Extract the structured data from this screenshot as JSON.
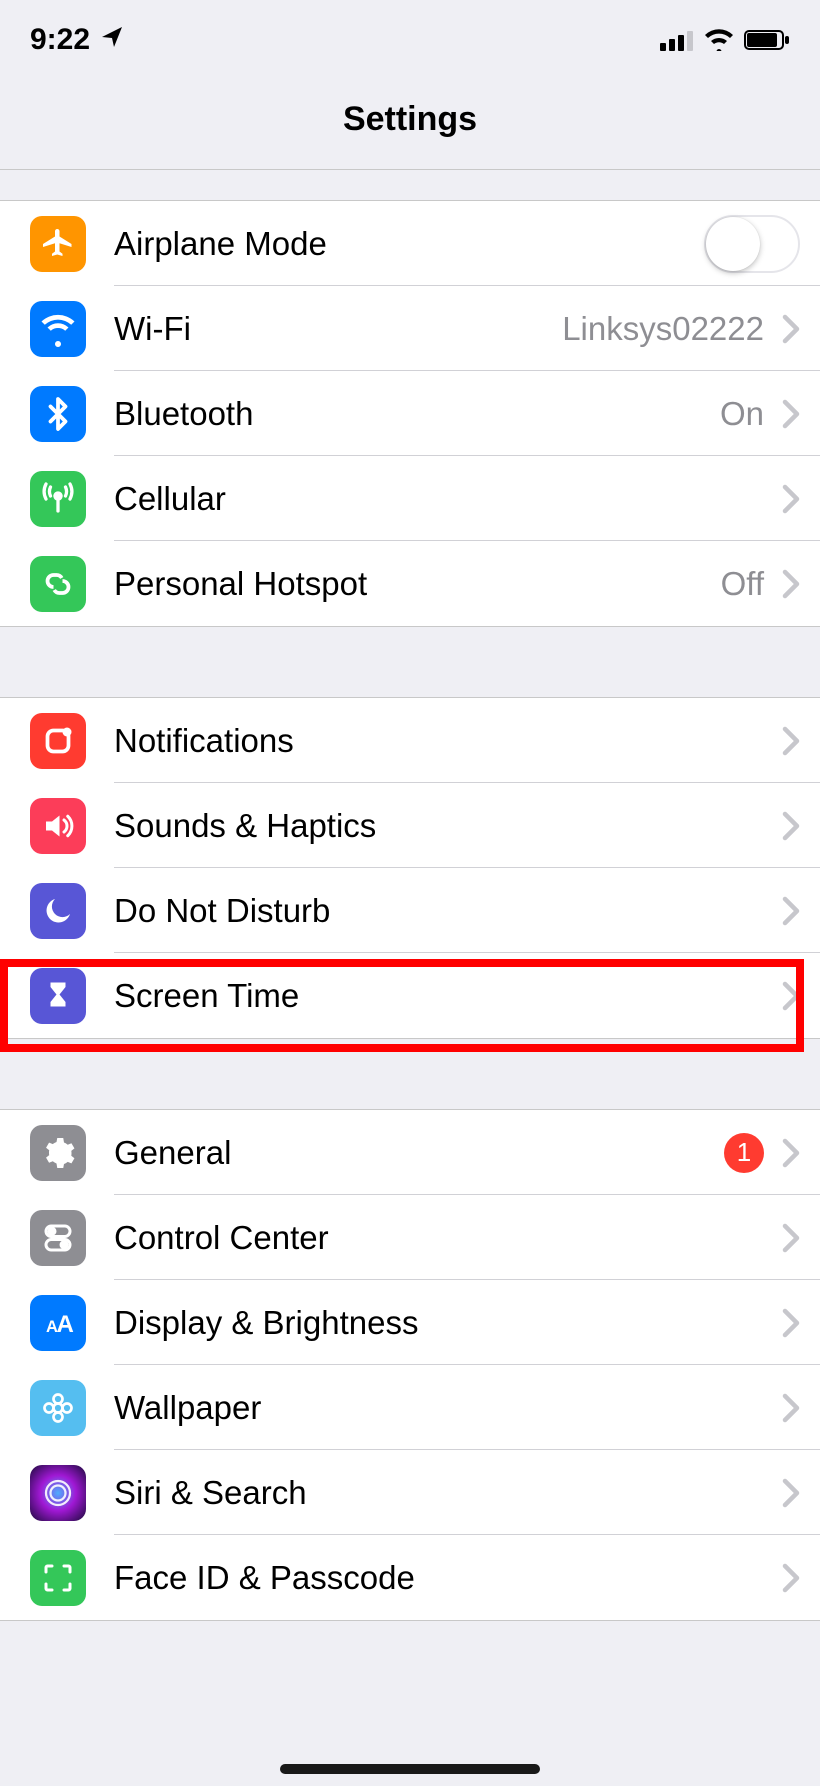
{
  "status": {
    "time": "9:22",
    "location_icon": "location-arrow",
    "cellular_icon": "cellular-signal",
    "wifi_icon": "wifi-signal",
    "battery_icon": "battery"
  },
  "title": "Settings",
  "groups": [
    {
      "rows": [
        {
          "id": "airplane-mode",
          "icon": "airplane-icon",
          "icon_bg": "bg-orange",
          "label": "Airplane Mode",
          "control": "toggle",
          "toggle_on": false
        },
        {
          "id": "wifi",
          "icon": "wifi-icon",
          "icon_bg": "bg-blue",
          "label": "Wi-Fi",
          "detail": "Linksys02222",
          "chevron": true
        },
        {
          "id": "bluetooth",
          "icon": "bluetooth-icon",
          "icon_bg": "bg-blue",
          "label": "Bluetooth",
          "detail": "On",
          "chevron": true
        },
        {
          "id": "cellular",
          "icon": "cellular-icon",
          "icon_bg": "bg-green",
          "label": "Cellular",
          "chevron": true
        },
        {
          "id": "hotspot",
          "icon": "hotspot-icon",
          "icon_bg": "bg-green",
          "label": "Personal Hotspot",
          "detail": "Off",
          "chevron": true
        }
      ]
    },
    {
      "rows": [
        {
          "id": "notifications",
          "icon": "notifications-icon",
          "icon_bg": "bg-red",
          "label": "Notifications",
          "chevron": true
        },
        {
          "id": "sounds",
          "icon": "speaker-icon",
          "icon_bg": "bg-pink",
          "label": "Sounds & Haptics",
          "chevron": true
        },
        {
          "id": "dnd",
          "icon": "moon-icon",
          "icon_bg": "bg-indigo",
          "label": "Do Not Disturb",
          "chevron": true
        },
        {
          "id": "screen-time",
          "icon": "hourglass-icon",
          "icon_bg": "bg-indigo",
          "label": "Screen Time",
          "chevron": true,
          "highlighted": true
        }
      ]
    },
    {
      "rows": [
        {
          "id": "general",
          "icon": "gear-icon",
          "icon_bg": "bg-gray",
          "label": "General",
          "badge": "1",
          "chevron": true
        },
        {
          "id": "control-center",
          "icon": "switches-icon",
          "icon_bg": "bg-gray",
          "label": "Control Center",
          "chevron": true
        },
        {
          "id": "display",
          "icon": "text-size-icon",
          "icon_bg": "bg-blue",
          "label": "Display & Brightness",
          "chevron": true
        },
        {
          "id": "wallpaper",
          "icon": "flower-icon",
          "icon_bg": "bg-lblue",
          "label": "Wallpaper",
          "chevron": true
        },
        {
          "id": "siri",
          "icon": "siri-icon",
          "icon_bg": "bg-siri",
          "label": "Siri & Search",
          "chevron": true
        },
        {
          "id": "faceid",
          "icon": "faceid-icon",
          "icon_bg": "bg-green",
          "label": "Face ID & Passcode",
          "chevron": true
        }
      ]
    }
  ],
  "annotation": {
    "visible": true,
    "target": "screen-time"
  }
}
